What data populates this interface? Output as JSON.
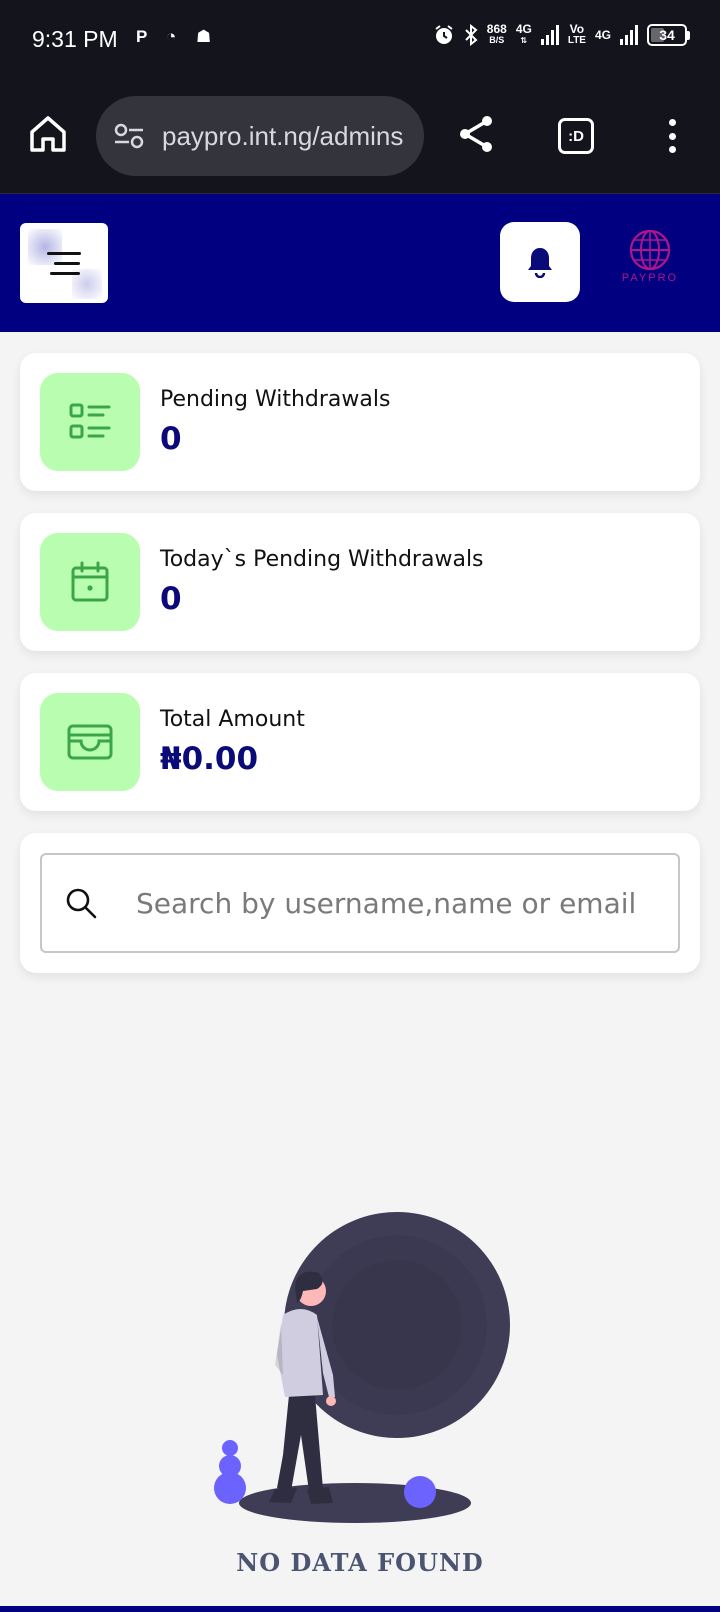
{
  "status_bar": {
    "time": "9:31 PM",
    "net_speed_value": "868",
    "net_speed_unit": "B/S",
    "network_1": "4G",
    "volte_top": "Vo",
    "volte_bottom": "LTE",
    "network_2": "4G",
    "battery": "34"
  },
  "browser": {
    "url": "paypro.int.ng/admins",
    "tabs_label": ":D"
  },
  "header": {
    "logo_text": "PAYPRO"
  },
  "stats": [
    {
      "label": "Pending Withdrawals",
      "value": "0",
      "icon": "list-icon"
    },
    {
      "label": "Today`s Pending Withdrawals",
      "value": "0",
      "icon": "calendar-icon"
    },
    {
      "label": "Total Amount",
      "value": "₦0.00",
      "icon": "wallet-icon"
    }
  ],
  "search": {
    "placeholder": "Search by username,name or email"
  },
  "empty_state": {
    "message": "NO DATA FOUND"
  },
  "colors": {
    "header_bg": "#000080",
    "icon_tile_bg": "#b9fdb0",
    "icon_stroke": "#3aa646",
    "value_text": "#0a0a78"
  }
}
